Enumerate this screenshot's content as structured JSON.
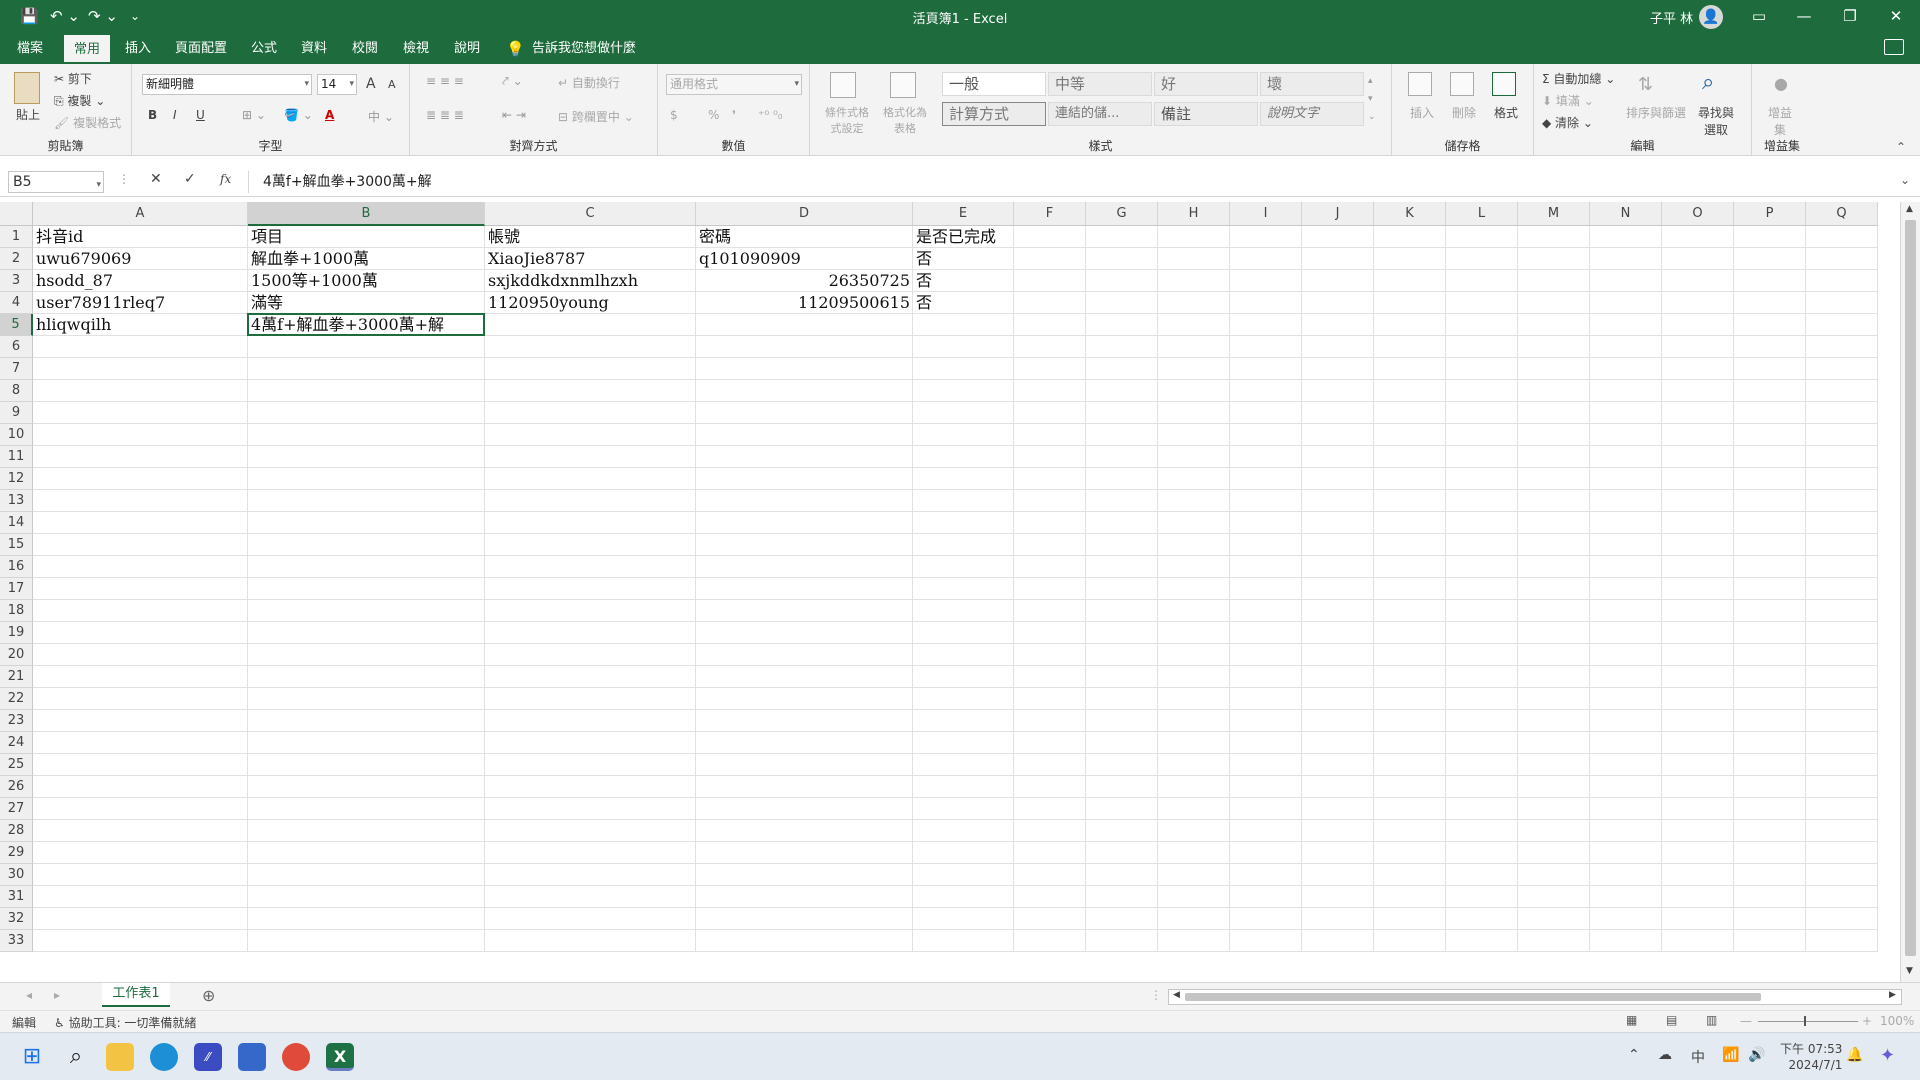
{
  "titlebar": {
    "doc_title": "活頁簿1 - Excel",
    "user_name": "子平 林",
    "avatar_glyph": "👤",
    "save_icon": "💾",
    "undo": "↶ ⌄",
    "redo": "↷ ⌄",
    "customize": "⌄",
    "ribbon_display": "▭",
    "minimize": "—",
    "restore": "❐",
    "close": "✕"
  },
  "tabs": {
    "items": [
      "檔案",
      "常用",
      "插入",
      "頁面配置",
      "公式",
      "資料",
      "校閱",
      "檢視",
      "說明"
    ],
    "active": "常用",
    "tell_me": "告訴我您想做什麼"
  },
  "ribbon": {
    "clipboard": {
      "label": "剪貼簿",
      "paste": "貼上",
      "cut": "剪下",
      "copy": "複製",
      "format_painter": "複製格式"
    },
    "font": {
      "label": "字型",
      "font_name": "新細明體",
      "font_size": "14",
      "grow": "A",
      "shrink": "A",
      "bold": "B",
      "italic": "I",
      "underline": "U"
    },
    "alignment": {
      "label": "對齊方式",
      "wrap": "自動換行",
      "merge": "跨欄置中"
    },
    "number": {
      "label": "數值",
      "format": "通用格式",
      "currency": "$",
      "percent": "%",
      "comma": "❜"
    },
    "styles": {
      "label": "樣式",
      "conditional": "條件式格式設定",
      "as_table": "格式化為表格",
      "cells": [
        "一般",
        "中等",
        "好",
        "壞",
        "計算方式",
        "連結的儲...",
        "備註",
        "說明文字"
      ]
    },
    "cells": {
      "label": "儲存格",
      "insert": "插入",
      "delete": "刪除",
      "format": "格式"
    },
    "editing": {
      "label": "編輯",
      "autosum": "自動加總",
      "fill": "填滿",
      "clear": "清除",
      "sort_filter": "排序與篩選",
      "find_select": "尋找與選取"
    },
    "addins": {
      "label": "增益集",
      "addins": "增益集"
    }
  },
  "formula_bar": {
    "name_box": "B5",
    "content": "4萬f+解血拳+3000萬+解",
    "cancel": "✕",
    "enter": "✓",
    "fx": "fx"
  },
  "grid": {
    "columns": [
      "A",
      "B",
      "C",
      "D",
      "E",
      "F",
      "G",
      "H",
      "I",
      "J",
      "K",
      "L",
      "M",
      "N",
      "O",
      "P",
      "Q"
    ],
    "selected_column": "B",
    "selected_row": 5,
    "rows": [
      {
        "n": 1,
        "A": "抖音id",
        "B": "項目",
        "C": "帳號",
        "D": "密碼",
        "E": "是否已完成"
      },
      {
        "n": 2,
        "A": "uwu679069",
        "B": "解血拳+1000萬",
        "C": "XiaoJie8787",
        "D": "q101090909",
        "E": "否"
      },
      {
        "n": 3,
        "A": "hsodd_87",
        "B": "1500等+1000萬",
        "C": "sxjkddkdxnmlhzxh",
        "D": "26350725",
        "E": "否"
      },
      {
        "n": 4,
        "A": "user78911rleq7",
        "B": "滿等",
        "C": "1120950young",
        "D": "11209500615",
        "E": "否"
      },
      {
        "n": 5,
        "A": "hliqwqilh",
        "B": "4萬f+解血拳+3000萬+解",
        "C": "",
        "D": "",
        "E": ""
      }
    ],
    "numeric_cells": [
      "D3",
      "D4"
    ],
    "row_count": 33
  },
  "sheets": {
    "tabs": [
      "工作表1"
    ],
    "add": "⊕"
  },
  "status": {
    "mode": "編輯",
    "accessibility": "協助工具: 一切準備就緒",
    "zoom": "100%"
  },
  "taskbar": {
    "time": "下午 07:53",
    "date": "2024/7/1",
    "ime": "中"
  }
}
